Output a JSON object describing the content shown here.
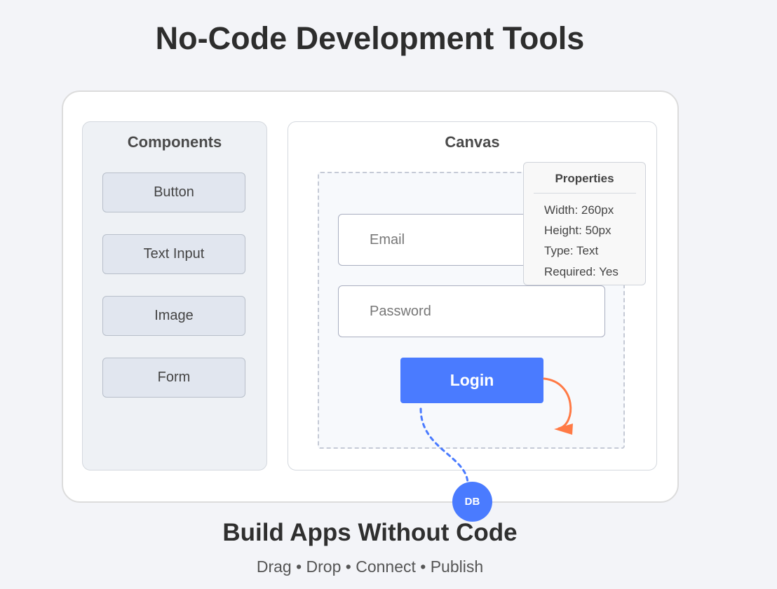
{
  "title": "No-Code Development Tools",
  "components_panel": {
    "title": "Components",
    "items": [
      "Button",
      "Text Input",
      "Image",
      "Form"
    ]
  },
  "canvas_panel": {
    "title": "Canvas",
    "email_placeholder": "Email",
    "password_placeholder": "Password",
    "login_label": "Login"
  },
  "properties_panel": {
    "title": "Properties",
    "rows": [
      "Width: 260px",
      "Height: 50px",
      "Type: Text",
      "Required: Yes"
    ]
  },
  "db_badge": "DB",
  "headline": "Build Apps Without Code",
  "tagline": "Drag • Drop • Connect • Publish",
  "colors": {
    "accent": "#4a7bff",
    "arrow": "#ff7a45",
    "background": "#f3f4f8"
  }
}
